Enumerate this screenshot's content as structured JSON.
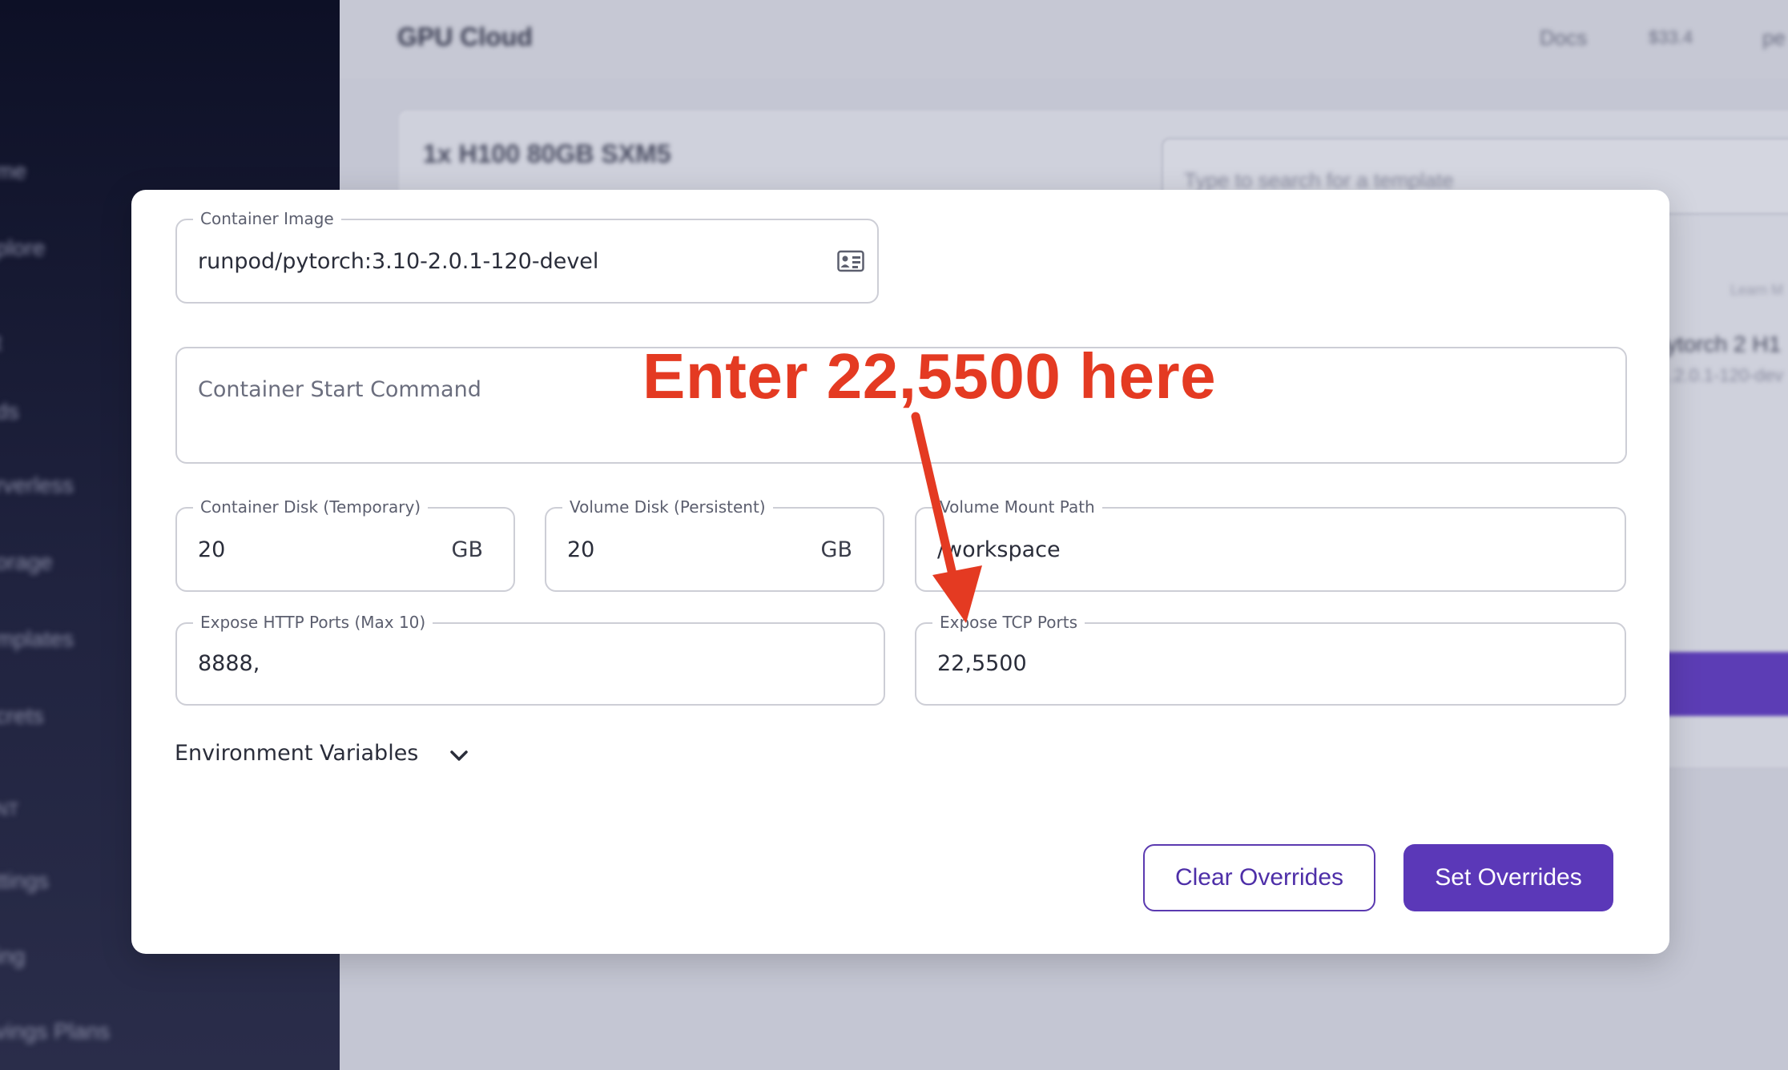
{
  "background": {
    "app_title": "GPU Cloud",
    "nav": {
      "docs": "Docs",
      "balance": "$33.4",
      "user": "pe"
    },
    "sidebar_items": [
      "me",
      "plore",
      "t",
      "ds",
      "rverless",
      "orage",
      "mplates",
      "crets",
      "NT",
      "ttings",
      "ing",
      "vings Plans"
    ],
    "gpu_name": "1x H100 80GB SXM5",
    "template_search_placeholder": "Type to search for a template",
    "template_learn": "Learn M",
    "template_title": "ytorch 2 H1",
    "template_subtitle": ".2.0.1-120-dev"
  },
  "modal": {
    "container_image": {
      "label": "Container Image",
      "value": "runpod/pytorch:3.10-2.0.1-120-devel",
      "icon": "id-card-icon"
    },
    "start_command": {
      "placeholder": "Container Start Command"
    },
    "container_disk": {
      "label": "Container Disk (Temporary)",
      "value": "20",
      "unit": "GB"
    },
    "volume_disk": {
      "label": "Volume Disk (Persistent)",
      "value": "20",
      "unit": "GB"
    },
    "volume_mount": {
      "label": "Volume Mount Path",
      "value": "/workspace"
    },
    "http_ports": {
      "label": "Expose HTTP Ports (Max 10)",
      "value": "8888,"
    },
    "tcp_ports": {
      "label": "Expose TCP Ports",
      "value": "22,5500"
    },
    "env_vars": {
      "label": "Environment Variables",
      "icon": "chevron-down-icon"
    },
    "buttons": {
      "clear": "Clear Overrides",
      "set": "Set Overrides"
    }
  },
  "annotation": {
    "text": "Enter 22,5500 here",
    "color": "#e43a22"
  },
  "colors": {
    "accent": "#5b38b8",
    "sidebar": "#14172f",
    "annotation": "#e43a22"
  }
}
